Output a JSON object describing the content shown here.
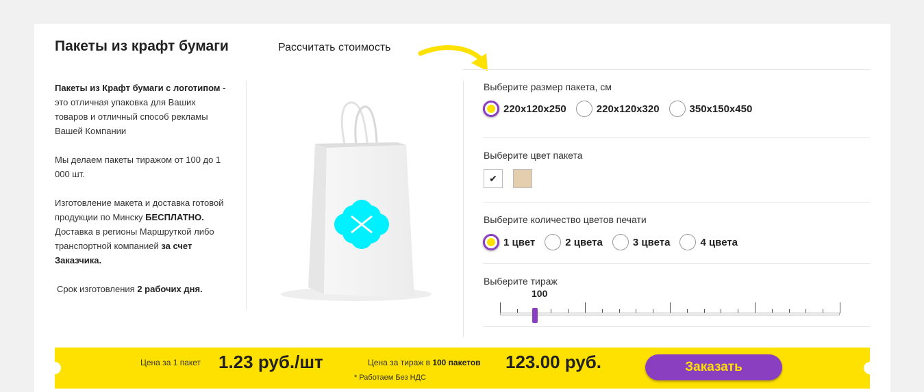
{
  "header": {
    "title": "Пакеты из крафт бумаги",
    "calc_link": "Рассчитать стоимость"
  },
  "description": {
    "p1_bold": "Пакеты из Крафт бумаги с логотипом",
    "p1_rest": " - это отличная упаковка для Ваших товаров и отличный способ рекламы Вашей Компании",
    "p2": "Мы делаем пакеты тиражом от 100 до 1 000 шт.",
    "p3_a": "Изготовление макета и доставка готовой продукции по Минску ",
    "p3_b": "БЕСПЛАТНО.",
    "p3_c": " Доставка в регионы Маршруткой либо транспортной компанией ",
    "p3_d": "за счет Заказчика.",
    "p4_a": "Срок изготовления ",
    "p4_b": "2 рабочих дня."
  },
  "size": {
    "label": "Выберите размер пакета, см",
    "options": [
      "220x120x250",
      "220x120x320",
      "350x150x450"
    ],
    "selected": "220x120x250"
  },
  "color": {
    "label": "Выберите цвет пакета",
    "options": [
      {
        "name": "white",
        "hex": "#ffffff",
        "mark": "✔"
      },
      {
        "name": "kraft",
        "hex": "#e3cfad"
      }
    ],
    "selected": "white"
  },
  "print_colors": {
    "label": "Выберите количество цветов печати",
    "options": [
      "1 цвет",
      "2 цвета",
      "3 цвета",
      "4 цвета"
    ],
    "selected": "1 цвет"
  },
  "quantity": {
    "label": "Выберите тираж",
    "value": "100",
    "min": 100,
    "max": 1000
  },
  "price": {
    "unit_label": "Цена за 1 пакет",
    "unit_value": "1.23 руб./шт",
    "total_label_a": "Цена за тираж в ",
    "total_label_b": "100 пакетов",
    "total_value": "123.00 руб.",
    "note": "* Работаем Без НДС",
    "order_button": "Заказать"
  },
  "colors": {
    "accent": "#8a3fc1",
    "yellow": "#ffe100",
    "logo": "#00f0ff"
  }
}
